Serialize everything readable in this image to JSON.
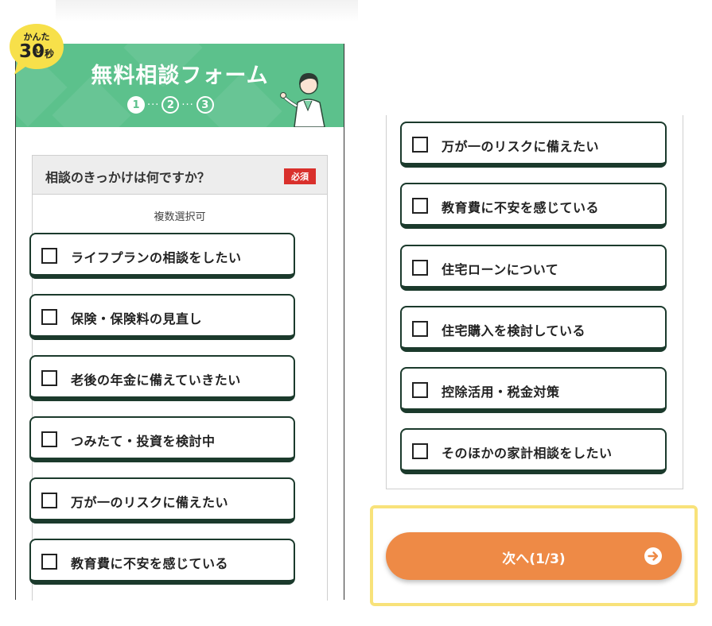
{
  "badge": {
    "small_text": "かんたん",
    "big_text": "30",
    "unit_text": "秒"
  },
  "banner": {
    "title": "無料相談フォーム",
    "steps": [
      "1",
      "2",
      "3"
    ],
    "step_dots": "···",
    "active_step": 1
  },
  "question": {
    "title": "相談のきっかけは何ですか？",
    "required_label": "必須",
    "hint": "複数選択可"
  },
  "left_options": [
    "ライフプランの相談をしたい",
    "保険・保険料の見直し",
    "老後の年金に備えていきたい",
    "つみたて・投資を検討中",
    "万が一のリスクに備えたい",
    "教育費に不安を感じている"
  ],
  "right_options": [
    "万が一のリスクに備えたい",
    "教育費に不安を感じている",
    "住宅ローンについて",
    "住宅購入を検討している",
    "控除活用・税金対策",
    "そのほかの家計相談をしたい"
  ],
  "next_button": {
    "label": "次へ(1/3)",
    "icon": "arrow-right-circle-icon"
  },
  "colors": {
    "banner_green": "#5cc18c",
    "required_red": "#d9302c",
    "next_orange": "#ee8a46",
    "highlight_yellow": "#f8e27a",
    "option_border": "#1b3a2c"
  }
}
